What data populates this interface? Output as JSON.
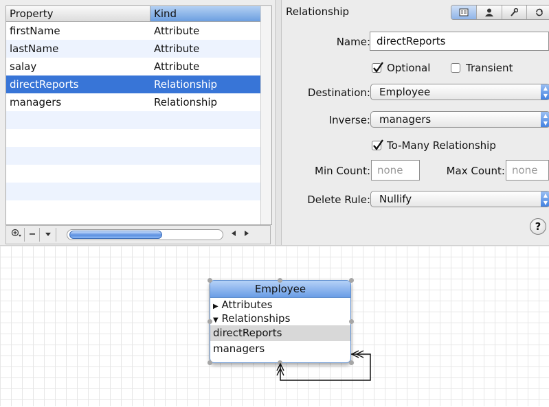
{
  "table": {
    "headers": [
      "Property",
      "Kind"
    ],
    "rows": [
      {
        "property": "firstName",
        "kind": "Attribute"
      },
      {
        "property": "lastName",
        "kind": "Attribute"
      },
      {
        "property": "salay",
        "kind": "Attribute"
      },
      {
        "property": "directReports",
        "kind": "Relationship",
        "selected": true
      },
      {
        "property": "managers",
        "kind": "Relationship"
      }
    ],
    "empty_rows": 6
  },
  "inspector": {
    "title": "Relationship",
    "tabs": [
      "general-icon",
      "user-icon",
      "wrench-icon",
      "sync-icon"
    ],
    "name_label": "Name:",
    "name_value": "directReports",
    "optional_label": "Optional",
    "optional_checked": true,
    "transient_label": "Transient",
    "transient_checked": false,
    "destination_label": "Destination:",
    "destination_value": "Employee",
    "inverse_label": "Inverse:",
    "inverse_value": "managers",
    "to_many_label": "To-Many Relationship",
    "to_many_checked": true,
    "min_count_label": "Min Count:",
    "min_count_placeholder": "none",
    "max_count_label": "Max Count:",
    "max_count_placeholder": "none",
    "delete_rule_label": "Delete Rule:",
    "delete_rule_value": "Nullify",
    "help_label": "?"
  },
  "entity": {
    "title": "Employee",
    "attributes_label": "Attributes",
    "relationships_label": "Relationships",
    "relationships": [
      "directReports",
      "managers"
    ],
    "selected_relationship": "directReports"
  },
  "colors": {
    "selection": "#3875d7",
    "header_blue": "#6c9fe0"
  }
}
